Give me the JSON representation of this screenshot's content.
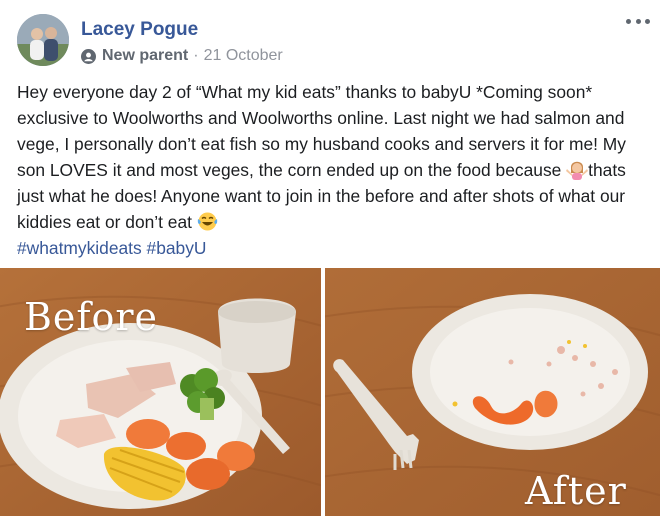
{
  "post": {
    "author": "Lacey Pogue",
    "badge": "New parent",
    "separator": "·",
    "date": "21 October",
    "body_part1": "Hey everyone day 2 of “What my kid eats” thanks to babyU *Coming soon* exclusive to Woolworths and Woolworths online. Last night we had salmon and vege, I personally don’t eat fish so my husband cooks and servers it for me! My son LOVES it and most veges, the corn ended up on the food because ",
    "body_part2": "thats just what he does! Anyone want to join in the before and after shots of what our kiddies eat or don’t eat ",
    "hashtags": [
      "#whatmykideats",
      "#babyU"
    ]
  },
  "photos": {
    "before_label": "Before",
    "after_label": "After"
  },
  "icons": {
    "badge": "new-parent-badge-icon",
    "shrug_emoji": "woman-shrugging-emoji",
    "laugh_emoji": "tears-of-joy-emoji",
    "more": "more-options-icon"
  },
  "colors": {
    "link": "#385898",
    "secondary": "#606770",
    "timestamp": "#90949c",
    "text": "#1c1e21"
  }
}
